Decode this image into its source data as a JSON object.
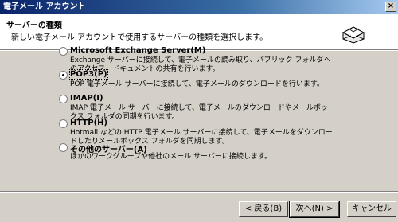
{
  "window": {
    "title": "電子メール アカウント",
    "close_glyph": "×"
  },
  "header": {
    "title": "サーバーの種類",
    "subtitle": "新しい電子メール アカウントで使用するサーバーの種類を選択します。",
    "icon": "mail-server-icon"
  },
  "options": [
    {
      "label": "Microsoft Exchange Server(M)",
      "desc": "Exchange サーバーに接続して、電子メールの読み取り、パブリック フォルダへのアクセス、ドキュメントの共有を行います。",
      "selected": false
    },
    {
      "label": "POP3(P)",
      "desc": "POP 電子メール サーバーに接続して、電子メールのダウンロードを行います。",
      "selected": true
    },
    {
      "label": "IMAP(I)",
      "desc": "IMAP 電子メール サーバーに接続して、電子メールのダウンロードやメールボックス フォルダの同期を行います。",
      "selected": false
    },
    {
      "label": "HTTP(H)",
      "desc": "Hotmail などの HTTP 電子メール サーバーに接続して、電子メールをダウンロードしたりメールボックス フォルダを同期します。",
      "selected": false
    },
    {
      "label": "その他のサーバー(A)",
      "desc": "ほかのワークグループや他社のメール サーバーに接続します。",
      "selected": false
    }
  ],
  "buttons": {
    "back": "< 戻る(B)",
    "next": "次へ(N) >",
    "cancel": "キャンセル"
  }
}
